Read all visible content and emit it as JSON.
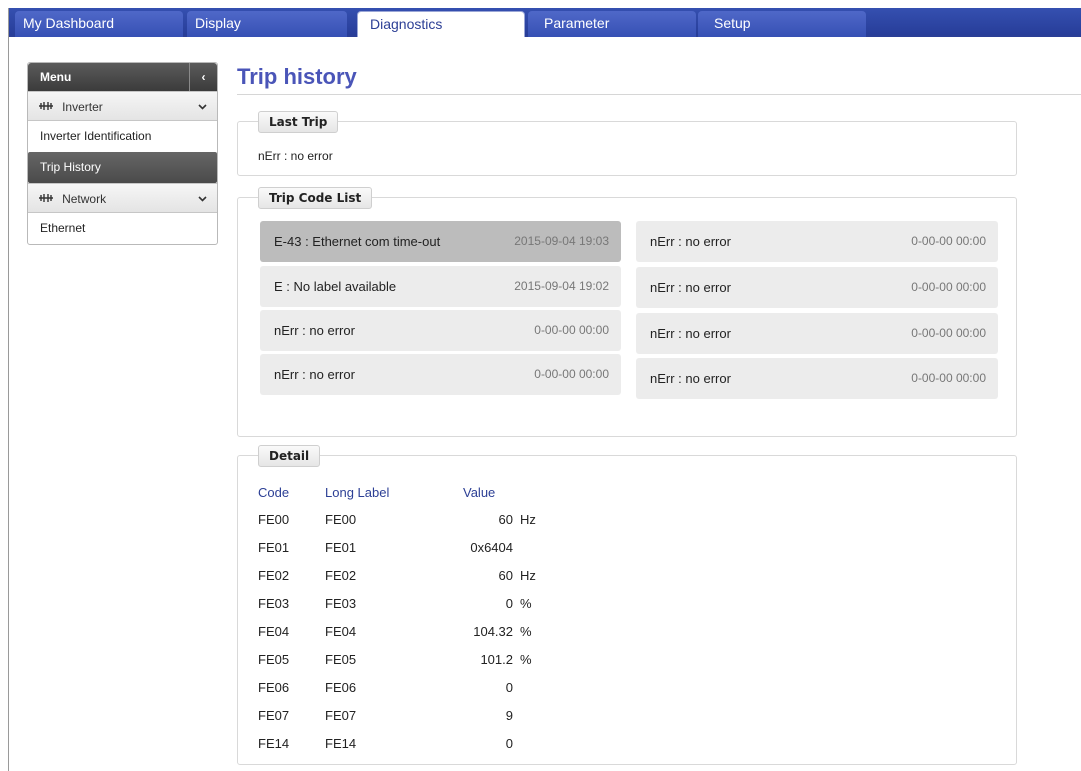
{
  "tabs": [
    {
      "label": "My Dashboard",
      "active": false
    },
    {
      "label": "Display",
      "active": false
    },
    {
      "label": "Diagnostics",
      "active": true
    },
    {
      "label": "Parameter",
      "active": false
    },
    {
      "label": "Setup",
      "active": false
    }
  ],
  "sidebar": {
    "menu_label": "Menu",
    "collapse_glyph": "‹",
    "groups": [
      {
        "label": "Inverter",
        "items": [
          "Inverter Identification",
          "Trip History"
        ]
      },
      {
        "label": "Network",
        "items": [
          "Ethernet"
        ]
      }
    ],
    "active_item": "Trip History"
  },
  "page_title": "Trip history",
  "last_trip": {
    "legend": "Last Trip",
    "text": "nErr : no error"
  },
  "trip_code_list": {
    "legend": "Trip Code List",
    "left": [
      {
        "label": "E-43 : Ethernet com time-out",
        "timestamp": "2015-09-04 19:03",
        "selected": true
      },
      {
        "label": "E : No label available",
        "timestamp": "2015-09-04 19:02",
        "selected": false
      },
      {
        "label": "nErr : no error",
        "timestamp": "0-00-00 00:00",
        "selected": false
      },
      {
        "label": "nErr : no error",
        "timestamp": "0-00-00 00:00",
        "selected": false
      }
    ],
    "right": [
      {
        "label": "nErr : no error",
        "timestamp": "0-00-00 00:00",
        "selected": false
      },
      {
        "label": "nErr : no error",
        "timestamp": "0-00-00 00:00",
        "selected": false
      },
      {
        "label": "nErr : no error",
        "timestamp": "0-00-00 00:00",
        "selected": false
      },
      {
        "label": "nErr : no error",
        "timestamp": "0-00-00 00:00",
        "selected": false
      }
    ]
  },
  "detail": {
    "legend": "Detail",
    "columns": [
      "Code",
      "Long Label",
      "Value"
    ],
    "rows": [
      {
        "code": "FE00",
        "label": "FE00",
        "value": "60",
        "unit": "Hz"
      },
      {
        "code": "FE01",
        "label": "FE01",
        "value": "0x6404",
        "unit": ""
      },
      {
        "code": "FE02",
        "label": "FE02",
        "value": "60",
        "unit": "Hz"
      },
      {
        "code": "FE03",
        "label": "FE03",
        "value": "0",
        "unit": "%"
      },
      {
        "code": "FE04",
        "label": "FE04",
        "value": "104.32",
        "unit": "%"
      },
      {
        "code": "FE05",
        "label": "FE05",
        "value": "101.2",
        "unit": "%"
      },
      {
        "code": "FE06",
        "label": "FE06",
        "value": "0",
        "unit": ""
      },
      {
        "code": "FE07",
        "label": "FE07",
        "value": "9",
        "unit": ""
      },
      {
        "code": "FE14",
        "label": "FE14",
        "value": "0",
        "unit": ""
      }
    ]
  },
  "icons": {
    "network_group": "network-icon",
    "chevron": "chevron-down-icon"
  },
  "colors": {
    "accent": "#2c3f95",
    "title": "#4a55b8",
    "selected_card": "#bcbcbc"
  }
}
